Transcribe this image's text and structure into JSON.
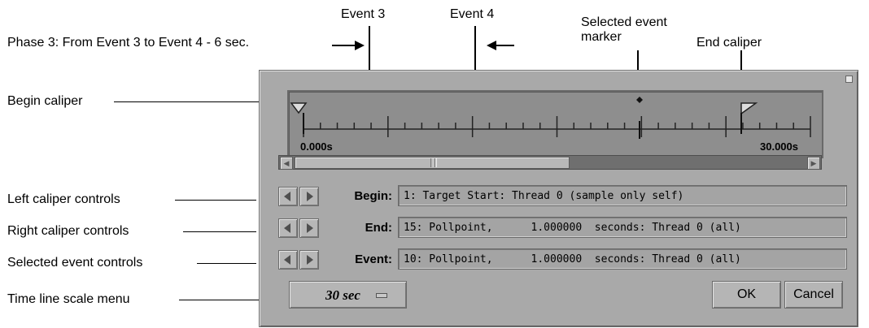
{
  "callouts": {
    "event3": "Event 3",
    "event4": "Event 4",
    "selected_marker": "Selected event\nmarker",
    "end_caliper": "End caliper",
    "phase3": "Phase 3: From Event 3 to Event 4 - 6 sec.",
    "begin_caliper": "Begin caliper",
    "left_caliper_controls": "Left caliper controls",
    "right_caliper_controls": "Right caliper controls",
    "selected_event_controls": "Selected event controls",
    "time_line_scale_menu": "Time line scale menu"
  },
  "timeline": {
    "start_label": "0.000s",
    "end_label": "30.000s"
  },
  "rows": {
    "begin": {
      "label": "Begin:",
      "value": "1: Target Start: Thread 0 (sample only self)"
    },
    "end": {
      "label": "End:",
      "value": "15: Pollpoint,      1.000000  seconds: Thread 0 (all)"
    },
    "event": {
      "label": "Event:",
      "value": "10: Pollpoint,      1.000000  seconds: Thread 0 (all)"
    }
  },
  "scale_menu": {
    "value": "30 sec"
  },
  "buttons": {
    "ok": "OK",
    "cancel": "Cancel"
  },
  "colors": {
    "window": "#a9a9a9",
    "timeline": "#8e8e8e",
    "field": "#a4a4a4"
  }
}
